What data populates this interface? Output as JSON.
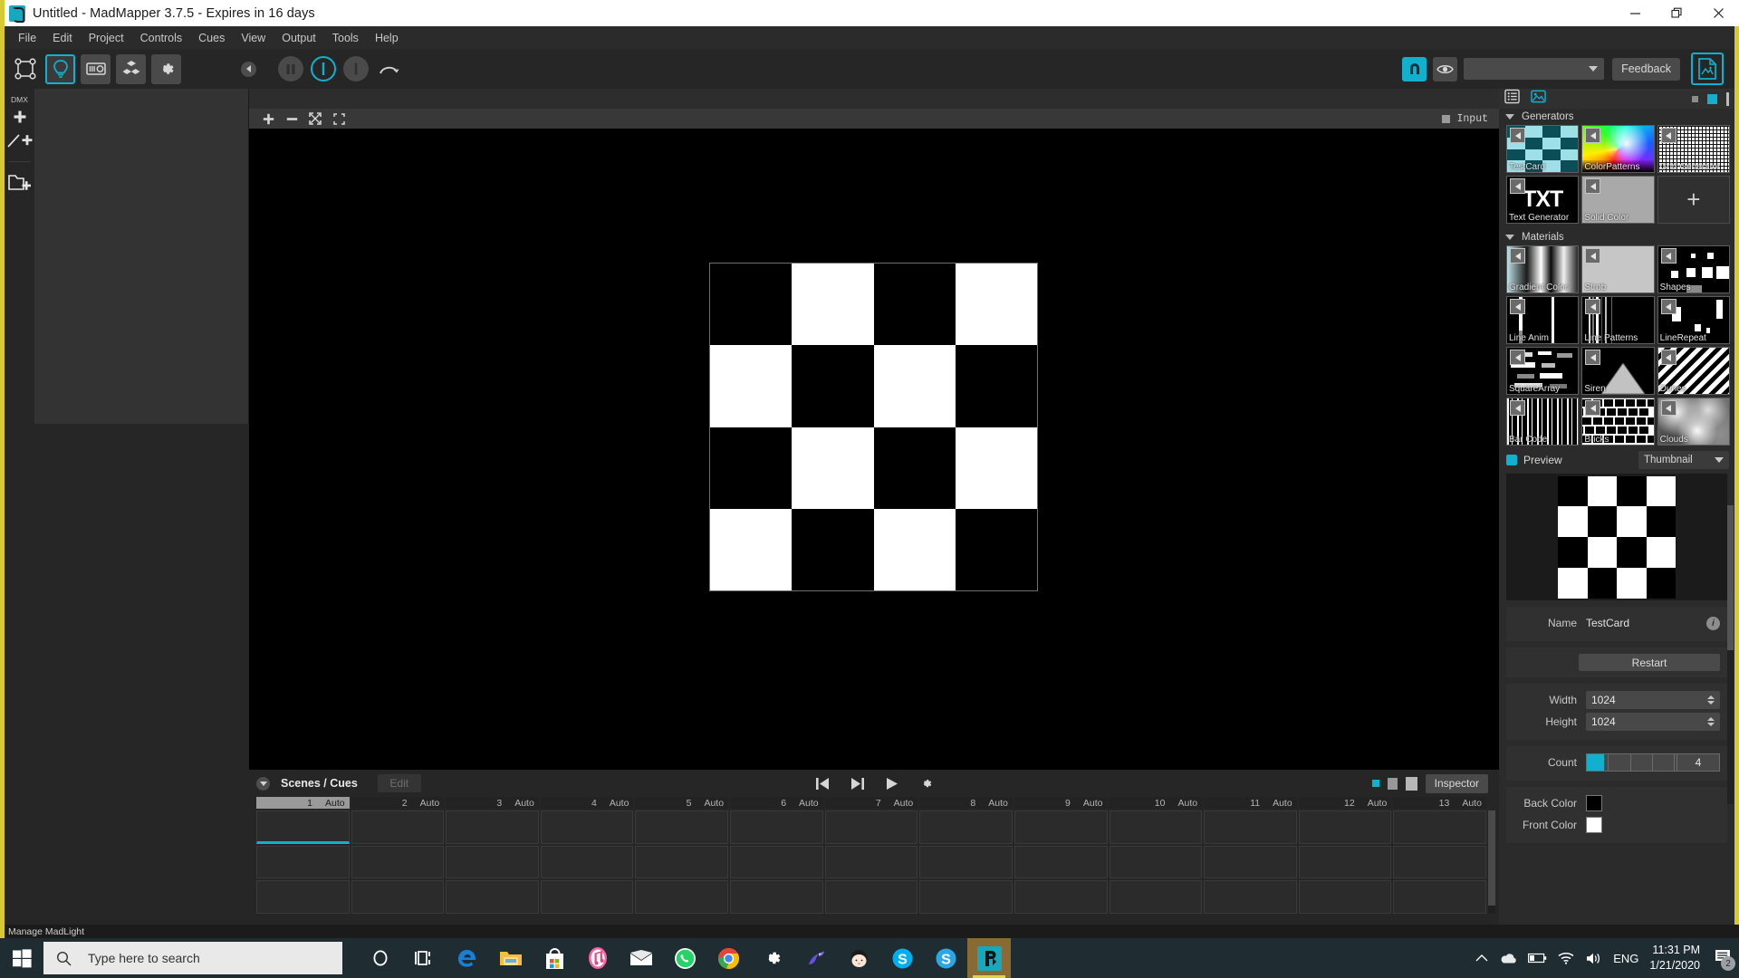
{
  "window": {
    "title": "Untitled - MadMapper 3.7.5 - Expires in 16 days",
    "app_icon": "madmapper-icon",
    "minimize": "minimize-icon",
    "maximize": "restore-icon",
    "close": "close-icon"
  },
  "menubar": {
    "items": [
      "File",
      "Edit",
      "Project",
      "Controls",
      "Cues",
      "View",
      "Output",
      "Tools",
      "Help"
    ]
  },
  "toolbar": {
    "buttons": [
      {
        "name": "surfaces-icon",
        "label": "Surfaces"
      },
      {
        "name": "light-bulb-icon",
        "label": "Fixtures"
      },
      {
        "name": "projector-icon",
        "label": "Projector"
      },
      {
        "name": "3d-cubes-icon",
        "label": "3D"
      },
      {
        "name": "gear-icon",
        "label": "Preferences"
      }
    ],
    "collapse": "collapse-left-arrow",
    "transport": [
      {
        "name": "pause-icon"
      },
      {
        "name": "record-ring-icon"
      },
      {
        "name": "bar-icon"
      },
      {
        "name": "redo-arc-icon"
      }
    ],
    "magnet": "magnet-icon",
    "eye": "eye-icon",
    "output_select_value": "",
    "feedback_label": "Feedback",
    "document_icon": "document-image-icon"
  },
  "left_rail": {
    "dmx_label": "DMX",
    "items": [
      {
        "name": "dmx-add-icon",
        "label": "DMX"
      },
      {
        "name": "line-add-icon",
        "label": ""
      },
      {
        "name": "folder-add-icon",
        "label": ""
      }
    ]
  },
  "viewport": {
    "tools": [
      {
        "name": "zoom-in-icon",
        "glyph": "+"
      },
      {
        "name": "zoom-out-icon",
        "glyph": "−"
      },
      {
        "name": "fit-screen-icon",
        "glyph": ""
      },
      {
        "name": "selection-icon",
        "glyph": ""
      }
    ],
    "input_label": "Input",
    "checker": {
      "rows": 4,
      "cols": 4,
      "start": "black",
      "back_color": "#000000",
      "front_color": "#ffffff"
    }
  },
  "scenes": {
    "title": "Scenes / Cues",
    "edit_label": "Edit",
    "transport": [
      {
        "name": "skip-back-icon"
      },
      {
        "name": "skip-forward-icon"
      },
      {
        "name": "play-icon"
      },
      {
        "name": "gear-icon"
      }
    ],
    "inspector_label": "Inspector",
    "cues": [
      {
        "num": "1",
        "mode": "Auto",
        "selected": true
      },
      {
        "num": "2",
        "mode": "Auto",
        "selected": false
      },
      {
        "num": "3",
        "mode": "Auto",
        "selected": false
      },
      {
        "num": "4",
        "mode": "Auto",
        "selected": false
      },
      {
        "num": "5",
        "mode": "Auto",
        "selected": false
      },
      {
        "num": "6",
        "mode": "Auto",
        "selected": false
      },
      {
        "num": "7",
        "mode": "Auto",
        "selected": false
      },
      {
        "num": "8",
        "mode": "Auto",
        "selected": false
      },
      {
        "num": "9",
        "mode": "Auto",
        "selected": false
      },
      {
        "num": "10",
        "mode": "Auto",
        "selected": false
      },
      {
        "num": "11",
        "mode": "Auto",
        "selected": false
      },
      {
        "num": "12",
        "mode": "Auto",
        "selected": false
      },
      {
        "num": "13",
        "mode": "Auto",
        "selected": false
      }
    ]
  },
  "right_panel": {
    "tabs": [
      {
        "name": "list-view-icon"
      },
      {
        "name": "media-view-icon"
      }
    ],
    "generators": {
      "title": "Generators",
      "items": [
        {
          "label": "TestCard",
          "thumb": "testcard"
        },
        {
          "label": "ColorPatterns",
          "thumb": "colorpatterns"
        },
        {
          "label": "Grid Generator",
          "thumb": "grid"
        },
        {
          "label": "Text Generator",
          "thumb": "txt"
        },
        {
          "label": "Solid Color",
          "thumb": "solid"
        },
        {
          "label": "+",
          "thumb": "add"
        }
      ]
    },
    "materials": {
      "title": "Materials",
      "items": [
        {
          "label": "Gradient Color",
          "thumb": "gradient"
        },
        {
          "label": "Strob",
          "thumb": "strob"
        },
        {
          "label": "Shapes",
          "thumb": "shapes"
        },
        {
          "label": "Line Anim",
          "thumb": "lineanim"
        },
        {
          "label": "Line Patterns",
          "thumb": "linepatterns"
        },
        {
          "label": "LineRepeat",
          "thumb": "linerepeat"
        },
        {
          "label": "SquareArray",
          "thumb": "squarearray"
        },
        {
          "label": "Siren",
          "thumb": "siren"
        },
        {
          "label": "Dunes",
          "thumb": "dunes"
        },
        {
          "label": "Bar Code",
          "thumb": "barcode"
        },
        {
          "label": "Bricks",
          "thumb": "bricks"
        },
        {
          "label": "Clouds",
          "thumb": "clouds"
        }
      ]
    },
    "preview": {
      "title": "Preview",
      "mode": "Thumbnail"
    },
    "properties": {
      "name_label": "Name",
      "name_value": "TestCard",
      "info_icon": "info-icon",
      "restart_label": "Restart",
      "width_label": "Width",
      "width_value": "1024",
      "height_label": "Height",
      "height_value": "1024",
      "count_label": "Count",
      "count_value": "4",
      "count_fill_percent": 13,
      "back_color_label": "Back Color",
      "back_color_value": "#000000",
      "front_color_label": "Front Color",
      "front_color_value": "#ffffff"
    }
  },
  "statusbar": {
    "text": "Manage MadLight"
  },
  "taskbar": {
    "start": "windows-start-icon",
    "search_placeholder": "Type here to search",
    "apps": [
      {
        "name": "cortana-icon"
      },
      {
        "name": "task-view-icon"
      },
      {
        "name": "edge-icon"
      },
      {
        "name": "file-explorer-icon"
      },
      {
        "name": "microsoft-store-icon"
      },
      {
        "name": "itunes-icon"
      },
      {
        "name": "mail-icon"
      },
      {
        "name": "whatsapp-icon"
      },
      {
        "name": "chrome-icon"
      },
      {
        "name": "settings-gear-icon"
      },
      {
        "name": "bird-app-icon"
      },
      {
        "name": "face-app-icon"
      },
      {
        "name": "skype-icon"
      },
      {
        "name": "skype-business-icon"
      },
      {
        "name": "madmapper-taskbar-icon",
        "active": true
      }
    ],
    "tray": {
      "chevron": "show-hidden-icons",
      "onedrive": "onedrive-icon",
      "battery": "battery-icon",
      "wifi": "wifi-icon",
      "volume": "volume-icon",
      "language": "ENG",
      "time": "11:31 PM",
      "date": "1/21/2020",
      "notifications_icon": "action-center-icon",
      "notifications_count": "2"
    }
  },
  "accent_colors": {
    "cyan": "#12b0cf",
    "panel_bg": "#2b2b2b",
    "app_bg": "#262626",
    "desktop": "#d8c832"
  }
}
